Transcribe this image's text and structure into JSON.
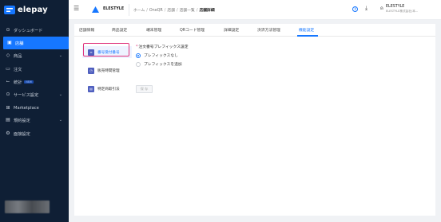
{
  "app": {
    "name": "elepay"
  },
  "sidebar": {
    "items": [
      {
        "label": "ダッシュボード",
        "icon": "dashboard-icon",
        "glyph": "⊙",
        "active": false,
        "chevron": false
      },
      {
        "label": "店舗",
        "icon": "store-icon",
        "glyph": "▣",
        "active": true,
        "chevron": false
      },
      {
        "label": "商品",
        "icon": "tag-icon",
        "glyph": "◇",
        "active": false,
        "chevron": true
      },
      {
        "label": "注文",
        "icon": "order-icon",
        "glyph": "▭",
        "active": false,
        "chevron": false
      },
      {
        "label": "統計",
        "icon": "chart-icon",
        "glyph": "⌙",
        "active": false,
        "chevron": false,
        "badge": "NEW"
      },
      {
        "label": "サービス設定",
        "icon": "service-icon",
        "glyph": "⊙",
        "active": false,
        "chevron": true
      },
      {
        "label": "Marketplace",
        "icon": "marketplace-icon",
        "glyph": "⊞",
        "active": false,
        "chevron": false
      },
      {
        "label": "規約設定",
        "icon": "terms-icon",
        "glyph": "▤",
        "active": false,
        "chevron": true
      },
      {
        "label": "面接設定",
        "icon": "settings-icon",
        "glyph": "⚙",
        "active": false,
        "chevron": false
      }
    ]
  },
  "header": {
    "org_name": "ELESTYLE",
    "breadcrumb": [
      "ホーム",
      "OneQR",
      "店舗",
      "店舗一覧",
      "店舗詳細"
    ],
    "user_name": "ELESTYLE",
    "user_sub": "ELESTYLE株式会社(本..."
  },
  "tabs": [
    {
      "label": "店舗情報",
      "active": false
    },
    {
      "label": "商品設定",
      "active": false
    },
    {
      "label": "端末管理",
      "active": false
    },
    {
      "label": "QRコード管理",
      "active": false
    },
    {
      "label": "詳細設定",
      "active": false
    },
    {
      "label": "決済方法管理",
      "active": false
    },
    {
      "label": "機能設定",
      "active": true
    }
  ],
  "side_menu": [
    {
      "label": "番号受付番号",
      "active": true
    },
    {
      "label": "販売時間管理",
      "active": false
    },
    {
      "label": "特定商取引法",
      "active": false
    }
  ],
  "form": {
    "label": "注文番号プレフィックス設定",
    "options": [
      {
        "label": "プレフィックスなし",
        "selected": true
      },
      {
        "label": "プレフィックスを追加",
        "selected": false
      }
    ],
    "save_label": "保 存"
  },
  "colors": {
    "sidebar_bg": "#0f1f35",
    "accent": "#1677ff",
    "highlight": "#e0337c"
  }
}
